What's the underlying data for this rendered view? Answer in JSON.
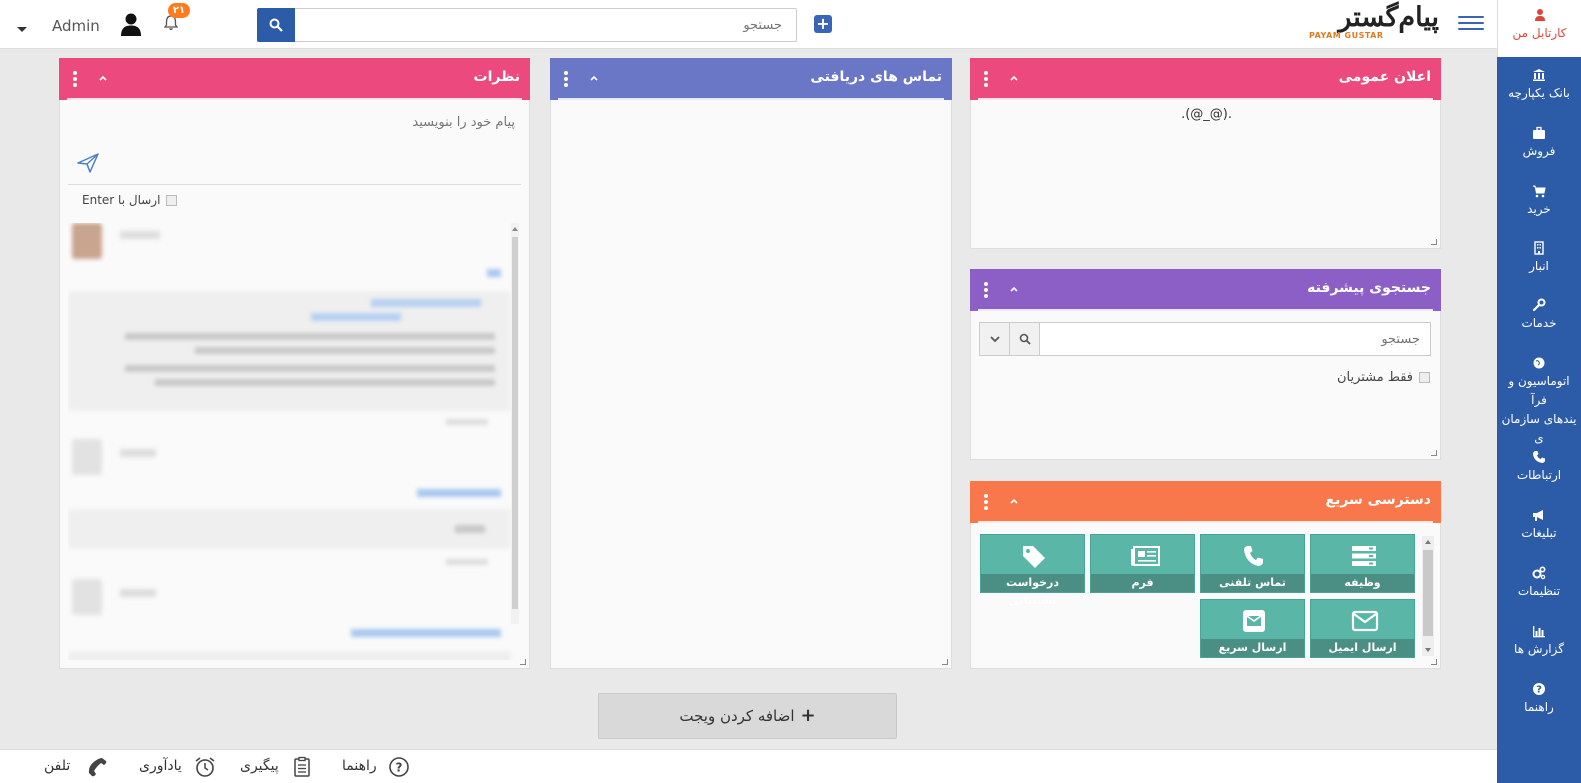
{
  "topbar": {
    "logo_text": "پیام‌گستر",
    "logo_sub": "PAYAM GUSTAR",
    "search_placeholder": "جستجو",
    "notification_count": "۲۱",
    "user_name": "Admin"
  },
  "sidebar": {
    "items": [
      {
        "label": "کارتابل من",
        "icon": "user-icon"
      },
      {
        "label": "بانک یکپارچه",
        "icon": "bank-icon"
      },
      {
        "label": "فروش",
        "icon": "briefcase-icon"
      },
      {
        "label": "خرید",
        "icon": "cart-icon"
      },
      {
        "label": "انبار",
        "icon": "building-icon"
      },
      {
        "label": "خدمات",
        "icon": "wrench-icon"
      },
      {
        "label": "اتوماسیون و فرآیندهای سازمانی",
        "line1": "اتوماسیون و فرآ",
        "line2": "یندهای سازمان",
        "line3": "ی",
        "icon": "globe-icon"
      },
      {
        "label": "ارتباطات",
        "icon": "phone-icon"
      },
      {
        "label": "تبلیغات",
        "icon": "megaphone-icon"
      },
      {
        "label": "تنظیمات",
        "icon": "cogs-icon"
      },
      {
        "label": "گزارش ها",
        "icon": "bar-chart-icon"
      },
      {
        "label": "راهنما",
        "icon": "question-icon"
      }
    ]
  },
  "panels": {
    "announcement": {
      "title": "اعلان عمومی",
      "text": ".(@_@).",
      "color": "#ec4a7e"
    },
    "advanced_search": {
      "title": "جستجوی پیشرفته",
      "placeholder": "جستجو",
      "only_customers": "فقط مشتریان",
      "color": "#8b5fc5"
    },
    "quick_access": {
      "title": "دسترسی سریع",
      "color": "#f8784b",
      "tiles": [
        {
          "label": "وظیفه",
          "icon": "tasks-icon"
        },
        {
          "label": "تماس تلفنی",
          "icon": "phone-icon"
        },
        {
          "label": "فرم",
          "icon": "newspaper-icon"
        },
        {
          "label": "درخواست پشتیبانی",
          "icon": "tag-icon"
        },
        {
          "label": "ارسال ایمیل",
          "icon": "envelope-icon"
        },
        {
          "label": "ارسال سریع",
          "icon": "envelope-square-icon"
        }
      ]
    },
    "received_calls": {
      "title": "تماس های دریافتی",
      "color": "#6a76c6"
    },
    "comments": {
      "title": "نظرات",
      "color": "#ec4a7e",
      "placeholder": "پیام خود را بنویسید",
      "send_with_enter": "ارسال با Enter"
    }
  },
  "add_widget": {
    "label": "اضافه کردن ویجت"
  },
  "footer": {
    "items": [
      {
        "label": "راهنما",
        "icon": "question-circle-icon"
      },
      {
        "label": "پیگیری",
        "icon": "clipboard-icon"
      },
      {
        "label": "یادآوری",
        "icon": "alarm-clock-icon"
      },
      {
        "label": "تلفن",
        "icon": "phone-icon"
      }
    ]
  }
}
